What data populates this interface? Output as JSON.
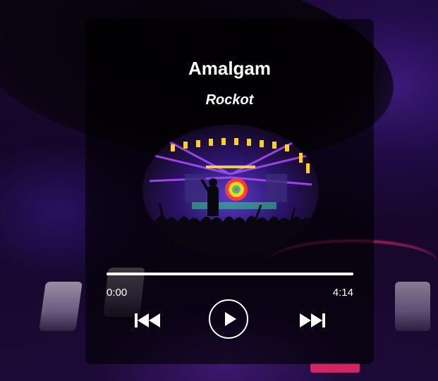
{
  "track": {
    "title": "Amalgam",
    "artist": "Rockot",
    "cover_icon": "concert-stage-image"
  },
  "progress": {
    "current_time": "0:00",
    "total_time": "4:14",
    "fraction_played": 1.0
  },
  "controls": {
    "prev_icon": "skip-previous-icon",
    "play_icon": "play-icon",
    "next_icon": "skip-next-icon"
  },
  "colors": {
    "text": "#ffffff",
    "card_background": "rgba(0,0,0,0.62)",
    "accent_glow": "#7b2cff"
  }
}
